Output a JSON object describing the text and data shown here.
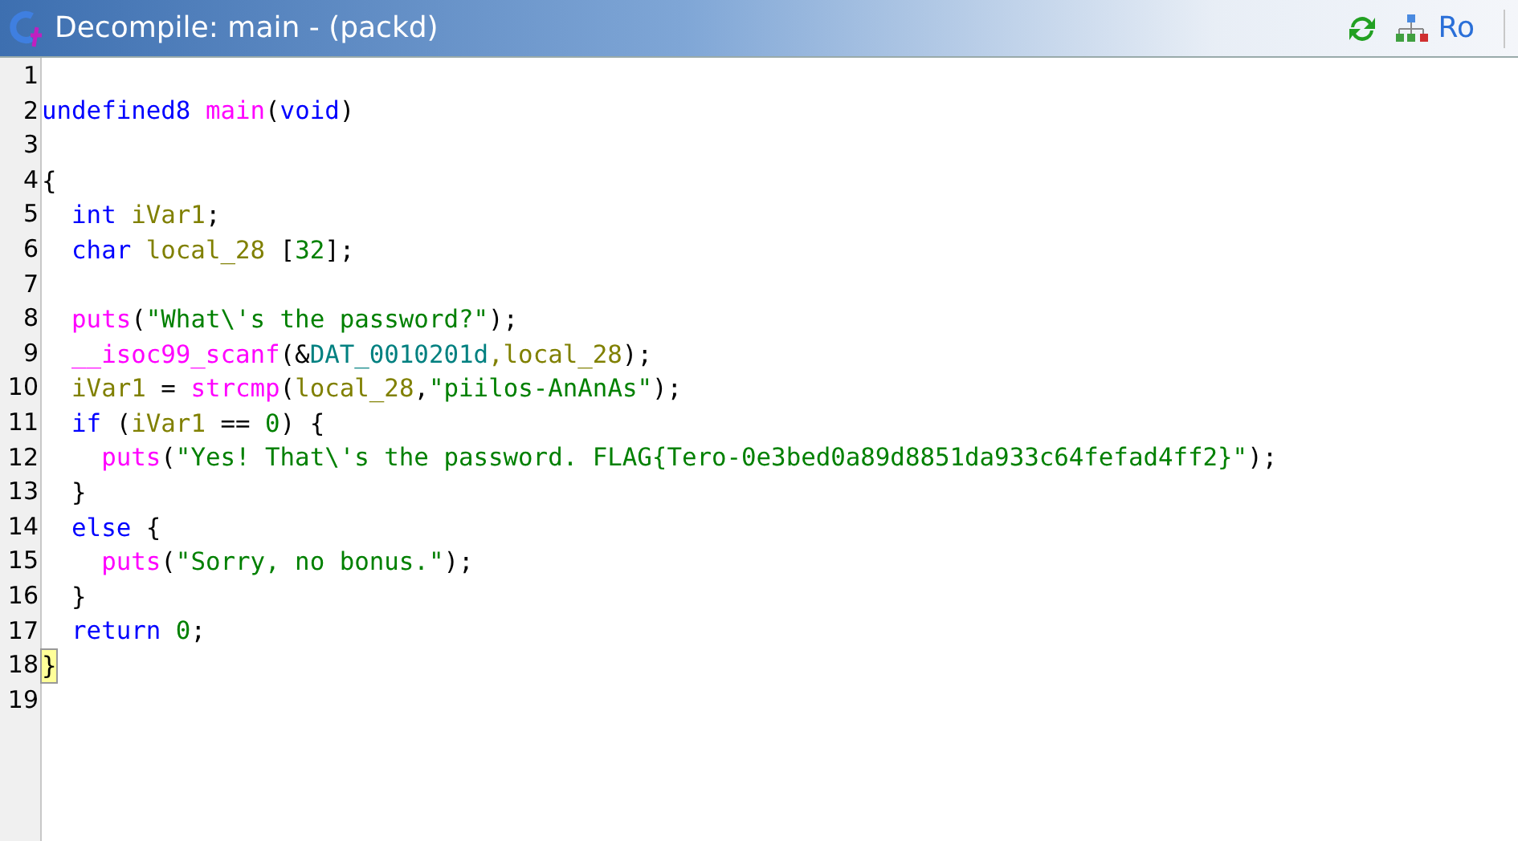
{
  "window": {
    "title": "Decompile: main - (packd)",
    "toolbar_text": "Ro"
  },
  "lines": [
    {
      "number": "1",
      "highlighted": false
    },
    {
      "number": "2",
      "highlighted": false,
      "tokens": [
        {
          "kind": "keyword",
          "text": "undefined8"
        },
        {
          "kind": "function",
          "text": " main"
        },
        {
          "kind": "plain",
          "text": "("
        },
        {
          "kind": "keyword",
          "text": "void"
        },
        {
          "kind": "plain",
          "text": ")"
        }
      ]
    },
    {
      "number": "3",
      "highlighted": false
    },
    {
      "number": "4",
      "highlighted": false,
      "tokens": [
        {
          "kind": "plain",
          "text": "{"
        }
      ]
    },
    {
      "number": "5",
      "highlighted": false,
      "tokens": [
        {
          "kind": "keyword",
          "text": "  int"
        },
        {
          "kind": "variable",
          "text": " iVar1"
        },
        {
          "kind": "plain",
          "text": ";"
        }
      ]
    },
    {
      "number": "6",
      "highlighted": false,
      "tokens": [
        {
          "kind": "keyword",
          "text": "  char"
        },
        {
          "kind": "variable",
          "text": " local_28"
        },
        {
          "kind": "plain",
          "text": " ["
        },
        {
          "kind": "constant",
          "text": "32"
        },
        {
          "kind": "plain",
          "text": "];"
        }
      ]
    },
    {
      "number": "7",
      "highlighted": false
    },
    {
      "number": "8",
      "highlighted": false,
      "tokens": [
        {
          "kind": "function",
          "text": "  puts"
        },
        {
          "kind": "plain",
          "text": "("
        },
        {
          "kind": "constant",
          "text": "\"What\\'s the password?\""
        },
        {
          "kind": "plain",
          "text": ");"
        }
      ]
    },
    {
      "number": "9",
      "highlighted": false,
      "tokens": [
        {
          "kind": "function",
          "text": "  __isoc99_scanf"
        },
        {
          "kind": "plain",
          "text": "(&"
        },
        {
          "kind": "global",
          "text": "DAT_0010201d"
        },
        {
          "kind": "variable",
          "text": ",local_28"
        },
        {
          "kind": "plain",
          "text": ");"
        }
      ]
    },
    {
      "number": "10",
      "highlighted": false,
      "tokens": [
        {
          "kind": "variable",
          "text": "  iVar1"
        },
        {
          "kind": "plain",
          "text": " = "
        },
        {
          "kind": "function",
          "text": "strcmp"
        },
        {
          "kind": "plain",
          "text": "("
        },
        {
          "kind": "variable",
          "text": "local_28"
        },
        {
          "kind": "plain",
          "text": ","
        },
        {
          "kind": "constant",
          "text": "\"piilos-AnAnAs\""
        },
        {
          "kind": "plain",
          "text": ");"
        }
      ]
    },
    {
      "number": "11",
      "highlighted": false,
      "tokens": [
        {
          "kind": "keyword",
          "text": "  if"
        },
        {
          "kind": "plain",
          "text": " ("
        },
        {
          "kind": "variable",
          "text": "iVar1"
        },
        {
          "kind": "plain",
          "text": " == "
        },
        {
          "kind": "constant",
          "text": "0"
        },
        {
          "kind": "plain",
          "text": ") {"
        }
      ]
    },
    {
      "number": "12",
      "highlighted": false,
      "tokens": [
        {
          "kind": "function",
          "text": "    puts"
        },
        {
          "kind": "plain",
          "text": "("
        },
        {
          "kind": "constant",
          "text": "\"Yes! That\\'s the password. FLAG{Tero-0e3bed0a89d8851da933c64fefad4ff2}\""
        },
        {
          "kind": "plain",
          "text": ");"
        }
      ]
    },
    {
      "number": "13",
      "highlighted": false,
      "tokens": [
        {
          "kind": "plain",
          "text": "  }"
        }
      ]
    },
    {
      "number": "14",
      "highlighted": false,
      "tokens": [
        {
          "kind": "keyword",
          "text": "  else"
        },
        {
          "kind": "plain",
          "text": " {"
        }
      ]
    },
    {
      "number": "15",
      "highlighted": false,
      "tokens": [
        {
          "kind": "function",
          "text": "    puts"
        },
        {
          "kind": "plain",
          "text": "("
        },
        {
          "kind": "constant",
          "text": "\"Sorry, no bonus.\""
        },
        {
          "kind": "plain",
          "text": ");"
        }
      ]
    },
    {
      "number": "16",
      "highlighted": false,
      "tokens": [
        {
          "kind": "plain",
          "text": "  }"
        }
      ]
    },
    {
      "number": "17",
      "highlighted": false,
      "tokens": [
        {
          "kind": "keyword",
          "text": "  return"
        },
        {
          "kind": "constant",
          "text": " 0"
        },
        {
          "kind": "plain",
          "text": ";"
        }
      ]
    },
    {
      "number": "18",
      "highlighted": true,
      "tokens": [
        {
          "kind": "plain",
          "text": "}"
        }
      ]
    },
    {
      "number": "19",
      "highlighted": false
    }
  ]
}
